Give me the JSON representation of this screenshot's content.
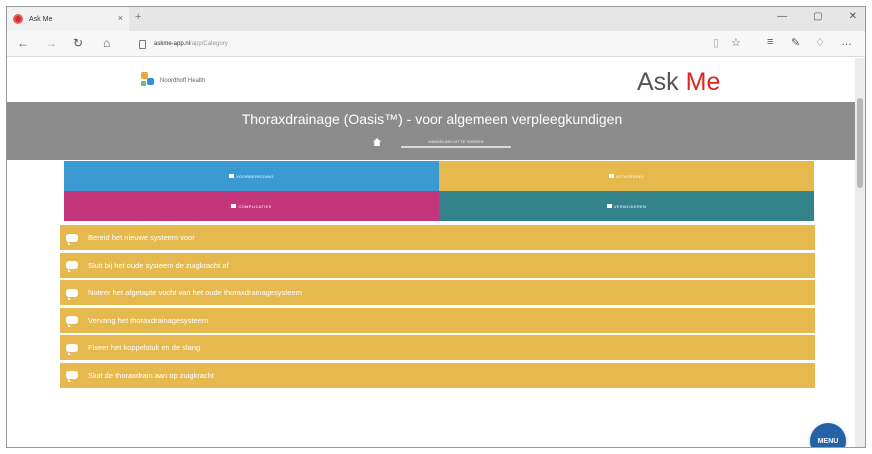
{
  "browser": {
    "tab_title": "Ask Me",
    "tab_close": "×",
    "new_tab": "+",
    "window_controls": [
      "—",
      "▢",
      "✕"
    ],
    "nav": {
      "back": "←",
      "forward": "→",
      "refresh": "↻",
      "home": "⌂",
      "url_host": "askme-app.nl",
      "url_path": "/app/Category",
      "reading_view": "▯",
      "favorite": "☆",
      "hub": "≡",
      "notes": "✎",
      "share": "♢",
      "more": "…"
    }
  },
  "header": {
    "brand_name": "Noordhoff Health",
    "app_title_prefix": "Ask ",
    "app_title_highlight": "Me"
  },
  "banner": {
    "title": "Thoraxdrainage (Oasis™) - voor algemeen verpleegkundigen",
    "breadcrumb": "HANDELING UIT TE VOEREN"
  },
  "tiles": [
    {
      "label": "VOORBEREIDING",
      "color": "#3b9ad2"
    },
    {
      "label": "UITVOERING",
      "color": "#e6b94f"
    },
    {
      "label": "COMPLICATIES",
      "color": "#c4367b"
    },
    {
      "label": "VERWIJDEREN",
      "color": "#34838b"
    }
  ],
  "steps": [
    "Bereid het nieuwe systeem voor",
    "Sluit bij het oude systeem de zuigkracht af",
    "Noteer het afgetapte vocht van het oude thoraxdrainagesysteem",
    "Vervang het thoraxdrainagesysteem",
    "Fixeer het koppelstuk en de slang",
    "Sluit de thoraxdrain aan op zuigkracht"
  ],
  "menu_button": "MENU"
}
